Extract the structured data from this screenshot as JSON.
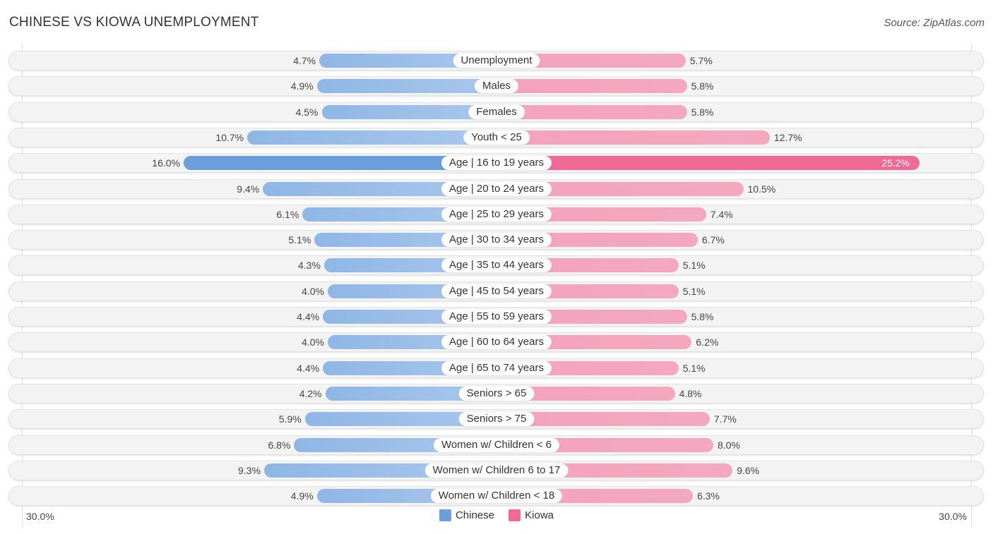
{
  "header": {
    "title": "CHINESE VS KIOWA UNEMPLOYMENT",
    "source": "Source: ZipAtlas.com"
  },
  "colors": {
    "chinese": "#6a9fdc",
    "kiowa": "#f06a95",
    "chinese_light": "#a3c3ea",
    "kiowa_light": "#f5a3be"
  },
  "chart_data": {
    "type": "bar",
    "orientation": "horizontal-diverging",
    "title": "CHINESE VS KIOWA UNEMPLOYMENT",
    "xlabel": "",
    "ylabel": "",
    "xlim": [
      0,
      30.0
    ],
    "axis_labels": {
      "left": "30.0%",
      "right": "30.0%"
    },
    "legend": {
      "position": "bottom-center",
      "entries": [
        "Chinese",
        "Kiowa"
      ]
    },
    "categories": [
      "Unemployment",
      "Males",
      "Females",
      "Youth < 25",
      "Age | 16 to 19 years",
      "Age | 20 to 24 years",
      "Age | 25 to 29 years",
      "Age | 30 to 34 years",
      "Age | 35 to 44 years",
      "Age | 45 to 54 years",
      "Age | 55 to 59 years",
      "Age | 60 to 64 years",
      "Age | 65 to 74 years",
      "Seniors > 65",
      "Seniors > 75",
      "Women w/ Children < 6",
      "Women w/ Children 6 to 17",
      "Women w/ Children < 18"
    ],
    "series": [
      {
        "name": "Chinese",
        "values": [
          4.7,
          4.9,
          4.5,
          10.7,
          16.0,
          9.4,
          6.1,
          5.1,
          4.3,
          4.0,
          4.4,
          4.0,
          4.4,
          4.2,
          5.9,
          6.8,
          9.3,
          4.9
        ]
      },
      {
        "name": "Kiowa",
        "values": [
          5.7,
          5.8,
          5.8,
          12.7,
          25.2,
          10.5,
          7.4,
          6.7,
          5.1,
          5.1,
          5.8,
          6.2,
          5.1,
          4.8,
          7.7,
          8.0,
          9.6,
          6.3
        ]
      }
    ],
    "value_labels": {
      "Chinese": [
        "4.7%",
        "4.9%",
        "4.5%",
        "10.7%",
        "16.0%",
        "9.4%",
        "6.1%",
        "5.1%",
        "4.3%",
        "4.0%",
        "4.4%",
        "4.0%",
        "4.4%",
        "4.2%",
        "5.9%",
        "6.8%",
        "9.3%",
        "4.9%"
      ],
      "Kiowa": [
        "5.7%",
        "5.8%",
        "5.8%",
        "12.7%",
        "25.2%",
        "10.5%",
        "7.4%",
        "6.7%",
        "5.1%",
        "5.1%",
        "5.8%",
        "6.2%",
        "5.1%",
        "4.8%",
        "7.7%",
        "8.0%",
        "9.6%",
        "6.3%"
      ]
    },
    "highlighted_category": "Age | 16 to 19 years"
  }
}
